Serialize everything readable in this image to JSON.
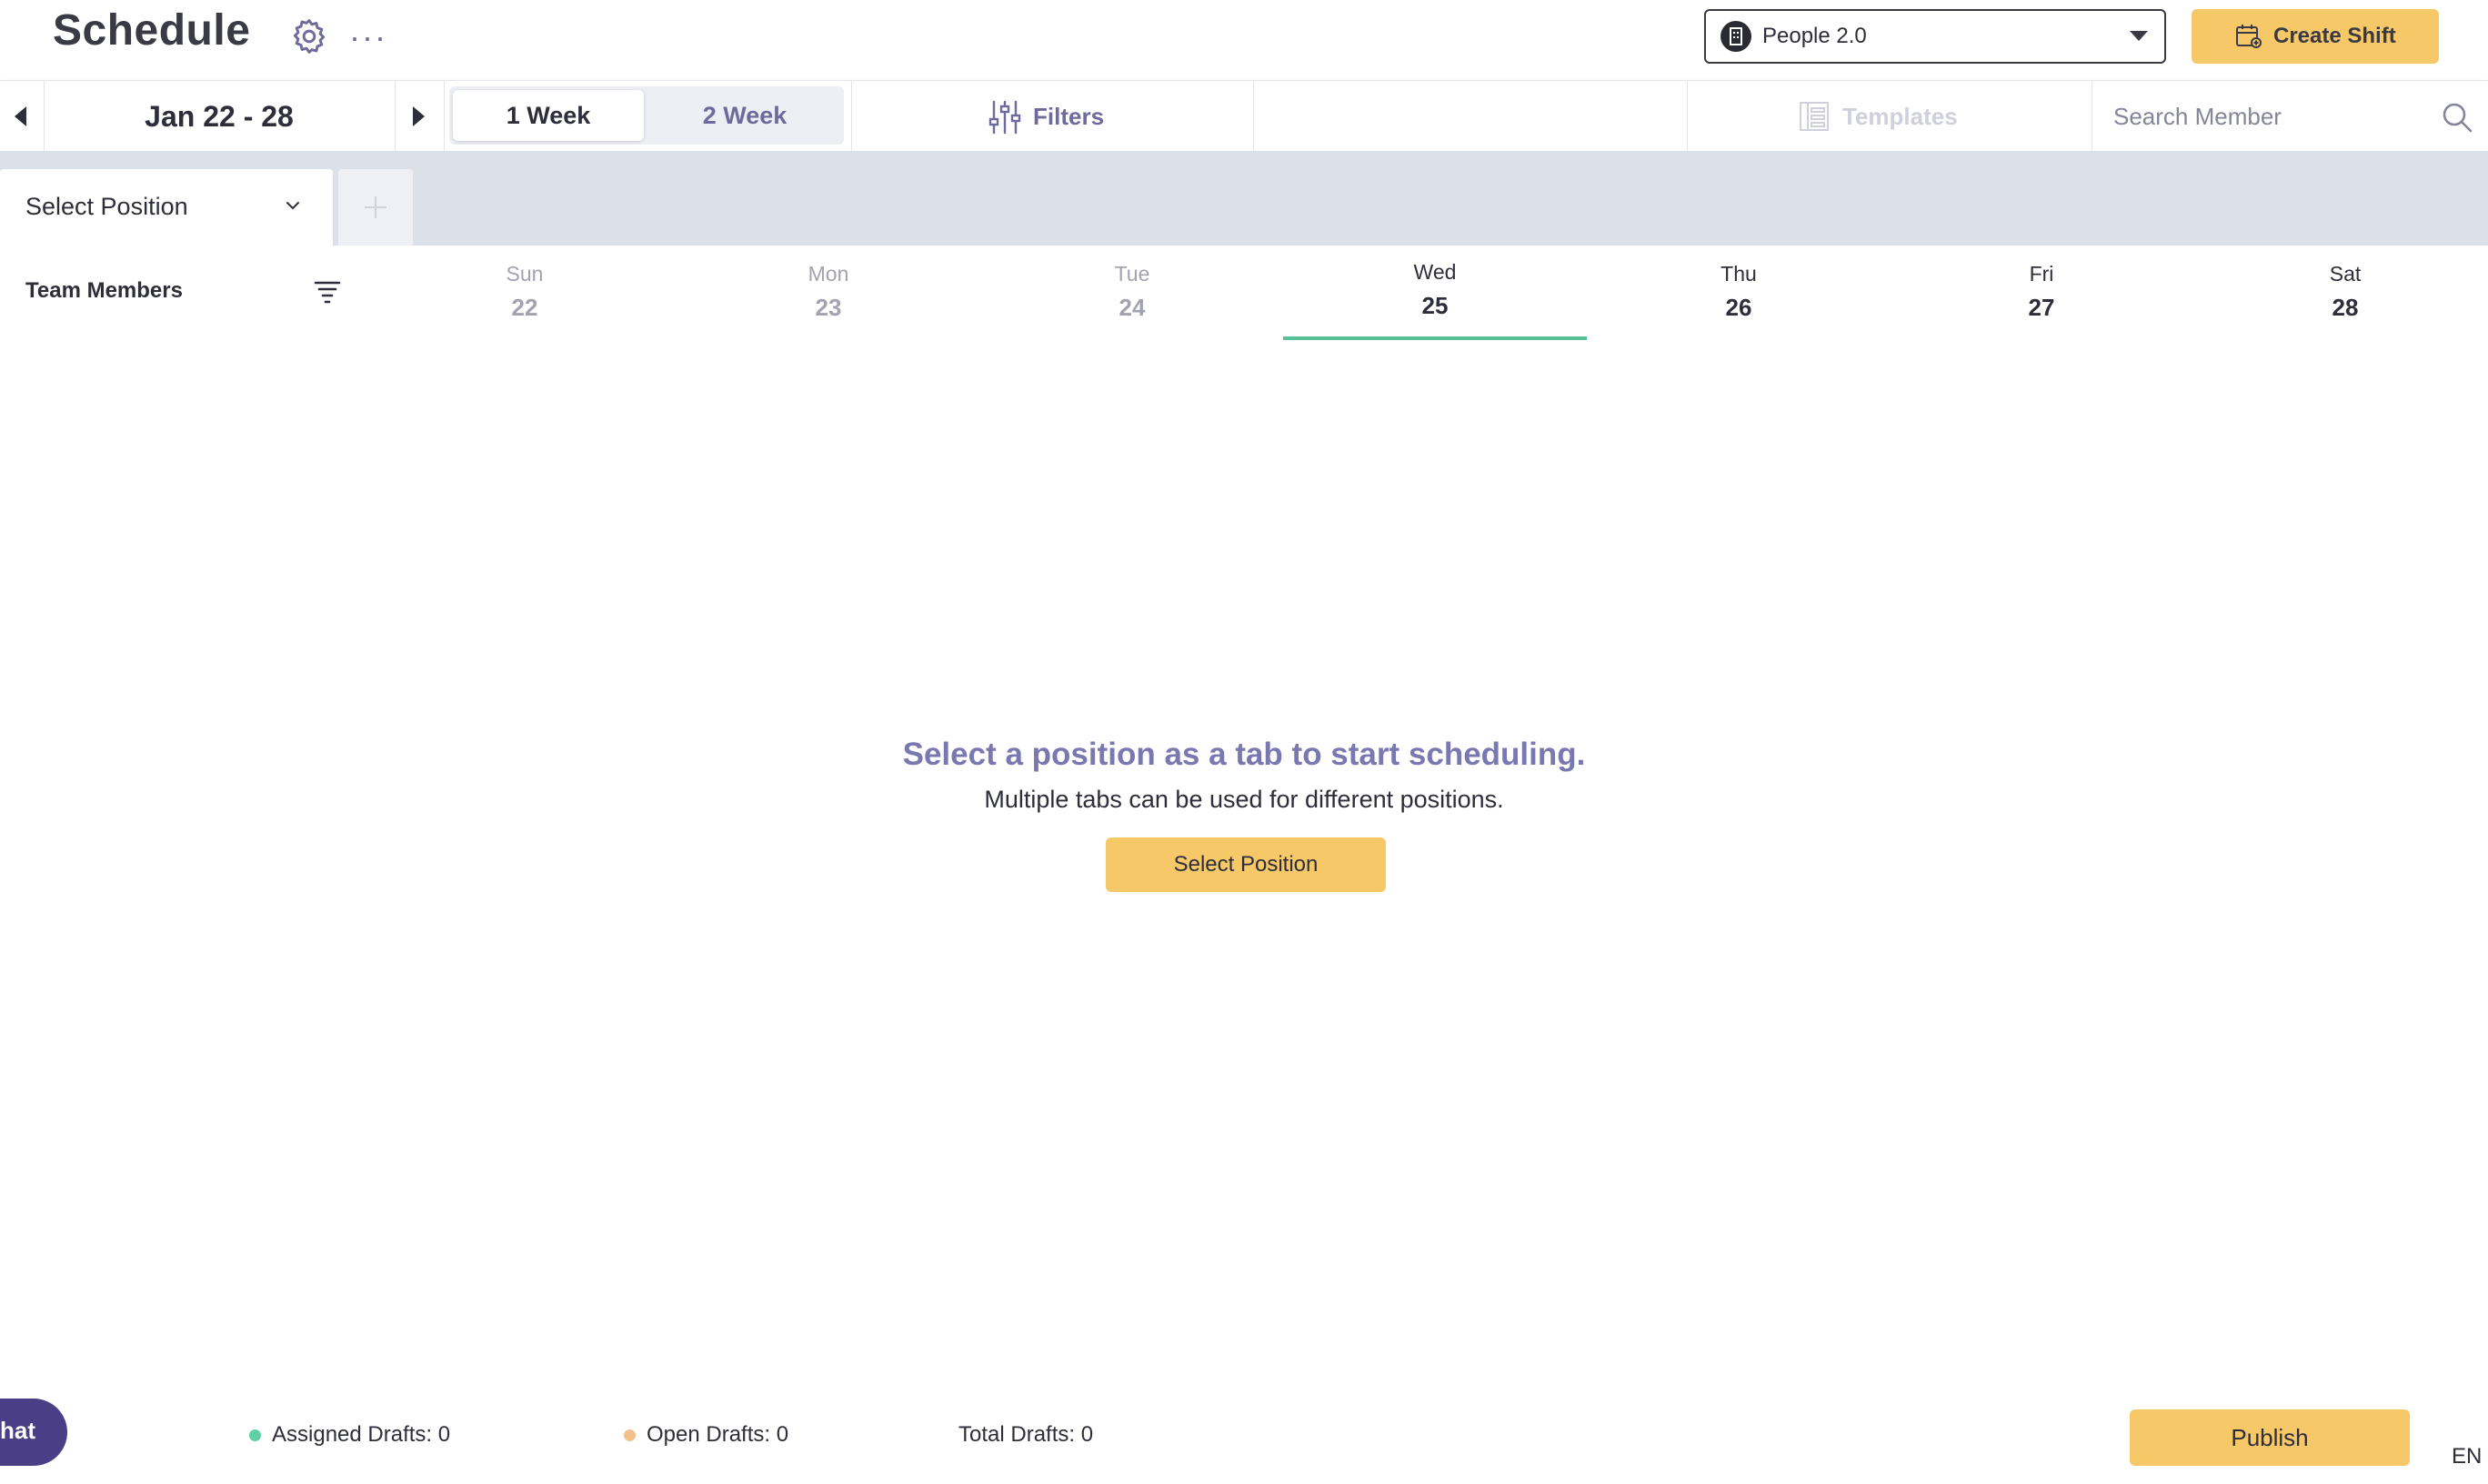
{
  "header": {
    "title": "Schedule",
    "settings_icon": "gear-icon",
    "more_icon": "more-dots-icon",
    "more_label": "···",
    "org_selector": {
      "value": "People 2.0",
      "logo_icon": "building-icon"
    },
    "create_shift_label": "Create Shift",
    "create_shift_icon": "calendar-plus-icon",
    "accent_color": "#f7c868"
  },
  "toolbar": {
    "date_range": "Jan 22 - 28",
    "range_tabs": [
      {
        "label": "1 Week",
        "selected": true
      },
      {
        "label": "2 Week",
        "selected": false
      }
    ],
    "filters_label": "Filters",
    "templates_label": "Templates",
    "search_placeholder": "Search Member"
  },
  "tabs_bar": {
    "position_tab_label": "Select Position"
  },
  "schedule": {
    "team_members_label": "Team Members",
    "days": [
      {
        "name": "Sun",
        "date": "22",
        "state": "past"
      },
      {
        "name": "Mon",
        "date": "23",
        "state": "past"
      },
      {
        "name": "Tue",
        "date": "24",
        "state": "past"
      },
      {
        "name": "Wed",
        "date": "25",
        "state": "today"
      },
      {
        "name": "Thu",
        "date": "26",
        "state": "future"
      },
      {
        "name": "Fri",
        "date": "27",
        "state": "future"
      },
      {
        "name": "Sat",
        "date": "28",
        "state": "future"
      }
    ],
    "today_underline_color": "#5bbf98"
  },
  "empty_state": {
    "title": "Select a position as a tab to start scheduling.",
    "subtitle": "Multiple tabs can be used for different positions.",
    "button_label": "Select Position"
  },
  "footer": {
    "chat_label": "hat",
    "assigned_drafts": "Assigned Drafts: 0",
    "assigned_color": "#5fd0a5",
    "open_drafts": "Open Drafts: 0",
    "open_color": "#f3c08c",
    "total_drafts": "Total Drafts: 0",
    "publish_label": "Publish",
    "language": "EN"
  }
}
